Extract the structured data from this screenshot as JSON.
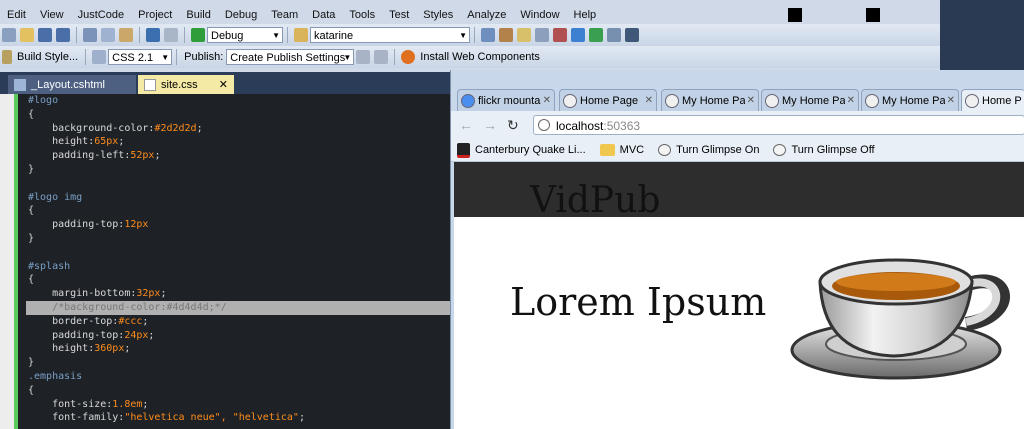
{
  "vs": {
    "menu": [
      "Edit",
      "View",
      "JustCode",
      "Project",
      "Build",
      "Debug",
      "Team",
      "Data",
      "Tools",
      "Test",
      "Styles",
      "Analyze",
      "Window",
      "Help"
    ],
    "toolbar1": {
      "config": "Debug",
      "search": "katarine"
    },
    "toolbar2": {
      "build_style": "Build Style...",
      "css_version": "CSS 2.1",
      "publish_label": "Publish:",
      "publish_profile": "Create Publish Settings",
      "install_web": "Install Web Components"
    },
    "tabs": [
      "_Layout.cshtml",
      "site.css"
    ]
  },
  "code": [
    "#logo",
    "{",
    "    background-color:#2d2d2d;",
    "    height:65px;",
    "    padding-left:52px;",
    "}",
    "",
    "#logo img",
    "{",
    "    padding-top:12px",
    "}",
    "",
    "#splash",
    "{",
    "    margin-bottom:32px;",
    "    /*background-color:#4d4d4d;*/",
    "    border-top:#ccc;",
    "    padding-top:24px;",
    "    height:360px;",
    "}",
    ".emphasis",
    "{",
    "    font-size:1.8em;",
    "    font-family:\"helvetica neue\", \"helvetica\";"
  ],
  "browser": {
    "tabs": [
      "flickr mounta",
      "Home Page",
      "My Home Pa",
      "My Home Pa",
      "My Home Pa",
      "Home Pa"
    ],
    "url_host": "localhost",
    "url_port": ":50363",
    "bookmarks": [
      "Canterbury Quake Li...",
      "MVC",
      "Turn Glimpse On",
      "Turn Glimpse Off"
    ],
    "page": {
      "logo": "VidPub",
      "heading": "Lorem Ipsum"
    }
  },
  "colors": {
    "code_selector": "#7a9fc4",
    "code_value": "#ff8c1a",
    "change_bar": "#5cc95c"
  }
}
